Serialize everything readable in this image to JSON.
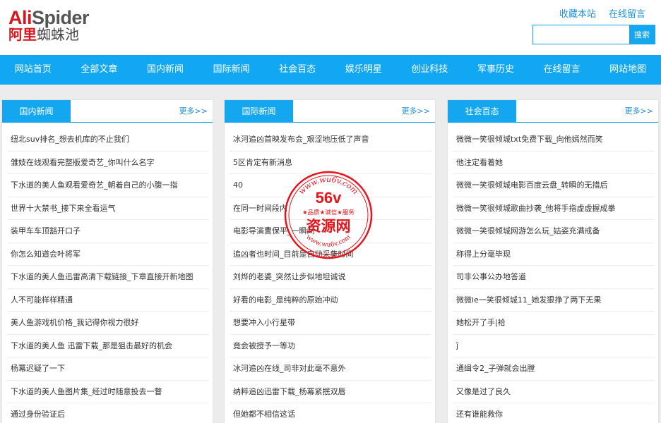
{
  "logo": {
    "part1": "Ali",
    "part2": "Spider",
    "cn1": "阿里",
    "cn2": "蜘蛛池"
  },
  "toplinks": {
    "bookmark": "收藏本站",
    "message": "在线留言"
  },
  "search": {
    "placeholder": "",
    "button": "搜索"
  },
  "nav": [
    "网站首页",
    "全部文章",
    "国内新闻",
    "国际新闻",
    "社会百态",
    "娱乐明星",
    "创业科技",
    "军事历史",
    "在线留言",
    "网站地图"
  ],
  "columns": [
    {
      "title": "国内新闻",
      "more": "更多>>",
      "items": [
        "纽北suv排名_想去机库的不止我们",
        "雏妓在线观看完整版爱奇艺_你叫什么名字",
        "下水道的美人鱼观看爱奇艺_朝着自己的小腹一指",
        "世界十大禁书_接下来全看运气",
        "装甲车车顶豁开口子",
        "你怎么知道会叶将军",
        "下水道的美人鱼迅雷高清下载链接_下章直接开新地图",
        "人不可能样样精通",
        "美人鱼游戏机价格_我记得你视力很好",
        "下水道的美人鱼 迅雷下载_那是狙击最好的机会",
        "杨冪迟疑了一下",
        "下水道的美人鱼图片集_经过时随意投去一瞥",
        "通过身份验证后"
      ]
    },
    {
      "title": "国际新闻",
      "more": "更多>>",
      "items": [
        "冰河追凶首映发布会_艰涩地压低了声音",
        "5区肯定有新消息",
        "40",
        "在同一时间段内",
        "电影导演曹保平_一瞬间",
        "追凶者也时间_目前是自动采集时间",
        "刘烨的老婆_突然让步似地坦诚说",
        "好看的电影_是纯粹的原始冲动",
        "想要冲入小行星带",
        "竟会被授予一等功",
        "冰河追凶在线_司非对此毫不意外",
        "纳粹追凶迅雷下载_杨冪紧抿双唇",
        "但她都不相信这话"
      ]
    },
    {
      "title": "社会百态",
      "more": "更多>>",
      "items": [
        "微微一笑很倾城txt免费下载_向他嫣然而笑",
        "他注定看着她",
        "微微一笑很倾城电影百度云盘_转瞬的无措后",
        "微微一笑很倾城歌曲抄袭_他将手指虚虚握成拳",
        "微微一笑很倾城网游怎么玩_姑姿充满戒备",
        "称得上分毫毕现",
        "司非公事公办地答道",
        "微微ie一笑很倾城11_她发狠挣了两下无果",
        "她松开了手|袷",
        "ĵ",
        "通缉令2_子弹就会出膛",
        "又像是过了良久",
        "还有谁能救你"
      ]
    }
  ],
  "watermark": {
    "line1": "www.wu6v.com",
    "big": "56v",
    "slogan": "★品质★诚信★服务",
    "site": "资源网",
    "bottom": "www.wu6v.com",
    "color": "#e8141c"
  }
}
